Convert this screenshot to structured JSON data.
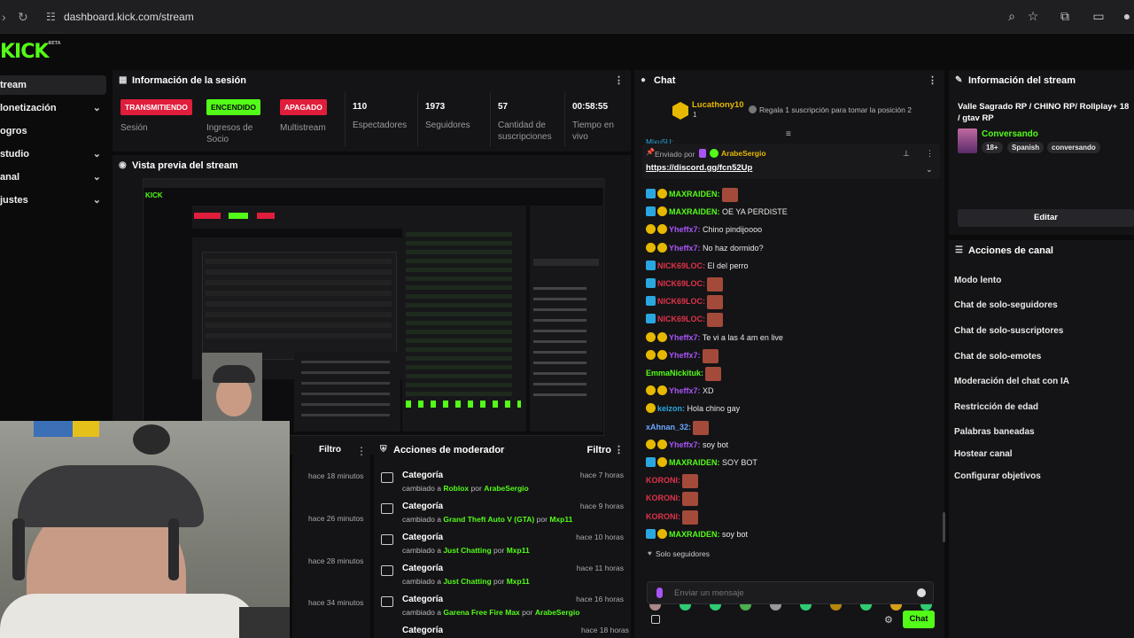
{
  "browser": {
    "url": "dashboard.kick.com/stream"
  },
  "sidebar": {
    "items": [
      {
        "label": "tream",
        "chev": ""
      },
      {
        "label": "lonetización",
        "chev": "⌄"
      },
      {
        "label": "ogros",
        "chev": ""
      },
      {
        "label": "studio",
        "chev": "⌄"
      },
      {
        "label": "anal",
        "chev": "⌄"
      },
      {
        "label": "justes",
        "chev": "⌄"
      }
    ]
  },
  "session": {
    "title": "Información de la sesión",
    "badges": [
      {
        "text": "TRANSMITIENDO",
        "label": "Sesión",
        "bg": "#e01e3c",
        "color": "#ffffff"
      },
      {
        "text": "ENCENDIDO",
        "label": "Ingresos de Socio",
        "bg": "#53fc18",
        "color": "#0b0b0c"
      },
      {
        "text": "APAGADO",
        "label": "Multistream",
        "bg": "#e01e3c",
        "color": "#ffffff"
      }
    ],
    "stats": [
      {
        "value": "110",
        "label": "Espectadores"
      },
      {
        "value": "1973",
        "label": "Seguidores"
      },
      {
        "value": "57",
        "label": "Cantidad de suscripciones"
      },
      {
        "value": "00:58:55",
        "label": "Tiempo en vivo"
      }
    ]
  },
  "preview": {
    "title": "Vista previa del stream"
  },
  "filter_panel": {
    "title": "Filtro",
    "times": [
      "hace 18 minutos",
      "hace 26 minutos",
      "hace 28 minutos",
      "hace 34 minutos"
    ]
  },
  "mod_actions": {
    "title": "Acciones de moderador",
    "filter": "Filtro",
    "rows": [
      {
        "cat": "Categoría",
        "changed": "cambiado a",
        "target": "Roblox",
        "by": "por",
        "user": "ArabeSergio",
        "time": "hace 7 horas"
      },
      {
        "cat": "Categoría",
        "changed": "cambiado a",
        "target": "Grand Theft Auto V (GTA)",
        "by": "por",
        "user": "Mxp11",
        "time": "hace 9 horas"
      },
      {
        "cat": "Categoría",
        "changed": "cambiado a",
        "target": "Just Chatting",
        "by": "por",
        "user": "Mxp11",
        "time": "hace 10 horas"
      },
      {
        "cat": "Categoría",
        "changed": "cambiado a",
        "target": "Just Chatting",
        "by": "por",
        "user": "Mxp11",
        "time": "hace 11 horas"
      },
      {
        "cat": "Categoría",
        "changed": "cambiado a",
        "target": "Garena Free Fire Max",
        "by": "por",
        "user": "ArabeSergio",
        "time": "hace 16 horas"
      }
    ],
    "cut_row": "Categoría",
    "cut_time": "hace 18 horas"
  },
  "chat": {
    "title": "Chat",
    "top_gifter": "Lucathony10",
    "top_gifter_count": "1",
    "gift_prompt": "Regala 1 suscripción para tomar la posición 2",
    "pinned_by_label": "Enviado por",
    "pinned_user": "ArabeSergio",
    "pinned_link": "https://discord.gg/fcn52Up",
    "cut_user": "Mixu5U:",
    "messages": [
      {
        "user": "MAXRAIDEN:",
        "color": "#53fc18",
        "msg": "",
        "emote": true,
        "icons": [
          "#2aa7e0",
          "#e6b800"
        ]
      },
      {
        "user": "MAXRAIDEN:",
        "color": "#53fc18",
        "msg": "OE YA PERDISTE",
        "emote": false,
        "icons": [
          "#2aa7e0",
          "#e6b800"
        ]
      },
      {
        "user": "Yheffx7:",
        "color": "#a855f7",
        "msg": "Chino pindijoooo",
        "emote": false,
        "icons": [
          "#e6b800",
          "#e6b800"
        ]
      },
      {
        "user": "Yheffx7:",
        "color": "#a855f7",
        "msg": "No haz dormido?",
        "emote": false,
        "icons": [
          "#e6b800",
          "#e6b800"
        ]
      },
      {
        "user": "NICK69LOC:",
        "color": "#e0324b",
        "msg": "El del perro",
        "emote": false,
        "icons": [
          "#2aa7e0"
        ]
      },
      {
        "user": "NICK69LOC:",
        "color": "#e0324b",
        "msg": "",
        "emote": true,
        "icons": [
          "#2aa7e0"
        ]
      },
      {
        "user": "NICK69LOC:",
        "color": "#e0324b",
        "msg": "",
        "emote": true,
        "icons": [
          "#2aa7e0"
        ]
      },
      {
        "user": "NICK69LOC:",
        "color": "#e0324b",
        "msg": "",
        "emote": true,
        "icons": [
          "#2aa7e0"
        ]
      },
      {
        "user": "Yheffx7:",
        "color": "#a855f7",
        "msg": "Te vi a las 4 am en live",
        "emote": false,
        "icons": [
          "#e6b800",
          "#e6b800"
        ]
      },
      {
        "user": "Yheffx7:",
        "color": "#a855f7",
        "msg": "",
        "emote": true,
        "icons": [
          "#e6b800",
          "#e6b800"
        ]
      },
      {
        "user": "EmmaNickituk:",
        "color": "#53fc18",
        "msg": "",
        "emote": true,
        "icons": []
      },
      {
        "user": "Yheffx7:",
        "color": "#a855f7",
        "msg": "XD",
        "emote": false,
        "icons": [
          "#e6b800",
          "#e6b800"
        ]
      },
      {
        "user": "keizon:",
        "color": "#2aa7e0",
        "msg": "Hola chino gay",
        "emote": false,
        "icons": [
          "#e6b800"
        ]
      },
      {
        "user": "xAhnan_32:",
        "color": "#6aa7ff",
        "msg": "",
        "emote": true,
        "icons": []
      },
      {
        "user": "Yheffx7:",
        "color": "#a855f7",
        "msg": "soy bot",
        "emote": false,
        "icons": [
          "#e6b800",
          "#e6b800"
        ]
      },
      {
        "user": "MAXRAIDEN:",
        "color": "#53fc18",
        "msg": "SOY BOT",
        "emote": false,
        "icons": [
          "#2aa7e0",
          "#e6b800"
        ]
      },
      {
        "user": "KORONI:",
        "color": "#e0324b",
        "msg": "",
        "emote": true,
        "icons": []
      },
      {
        "user": "KORONI:",
        "color": "#e0324b",
        "msg": "",
        "emote": true,
        "icons": []
      },
      {
        "user": "KORONI:",
        "color": "#e0324b",
        "msg": "",
        "emote": true,
        "icons": []
      },
      {
        "user": "MAXRAIDEN:",
        "color": "#53fc18",
        "msg": "soy bot",
        "emote": false,
        "icons": [
          "#2aa7e0",
          "#e6b800"
        ]
      }
    ],
    "followers_only": "Solo seguidores",
    "input_placeholder": "Enviar un mensaje",
    "send_label": "Chat"
  },
  "stream_info": {
    "title": "Información del stream",
    "stream_title": "Valle Sagrado RP / CHINO RP/ Rollplay+ 18 / gtav RP",
    "category": "Conversando",
    "tags": [
      "18+",
      "Spanish",
      "conversando"
    ],
    "edit_label": "Editar"
  },
  "channel_actions": {
    "title": "Acciones de canal",
    "items": [
      "Modo lento",
      "Chat de solo-seguidores",
      "Chat de solo-suscriptores",
      "Chat de solo-emotes",
      "Moderación del chat con IA",
      "Restricción de edad",
      "Palabras baneadas",
      "Hostear canal",
      "Configurar objetivos"
    ]
  },
  "colors": {
    "accent": "#53fc18",
    "danger": "#e01e3c",
    "panel": "#141416"
  }
}
